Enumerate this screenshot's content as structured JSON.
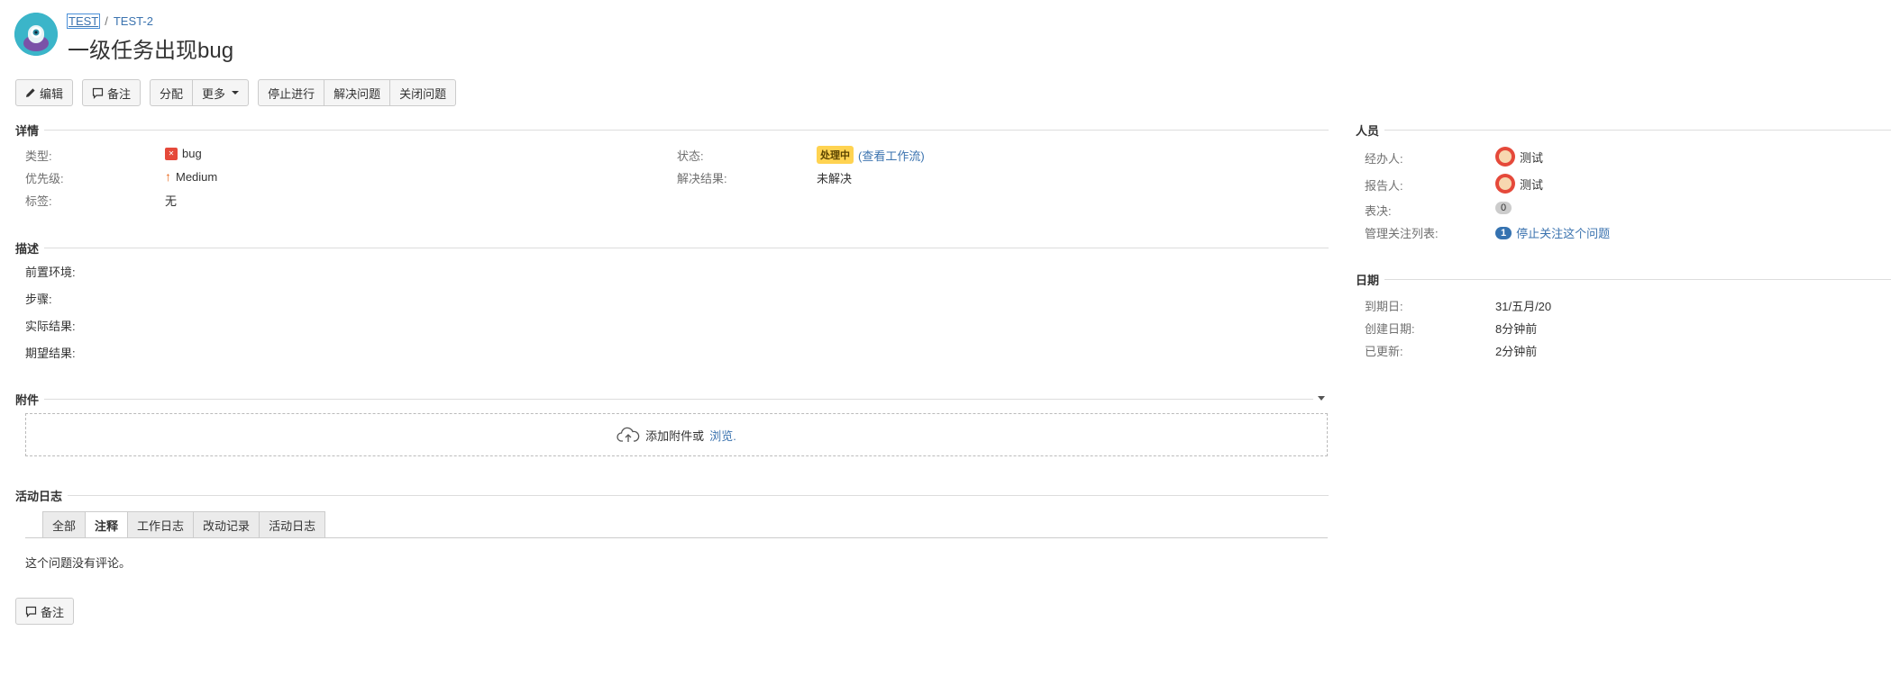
{
  "header": {
    "project_key": "TEST",
    "issue_key": "TEST-2",
    "separator": "/",
    "title": "一级任务出现bug"
  },
  "toolbar": {
    "edit": "编辑",
    "comment": "备注",
    "assign": "分配",
    "more": "更多",
    "stop_progress": "停止进行",
    "resolve": "解决问题",
    "close": "关闭问题"
  },
  "details": {
    "heading": "详情",
    "type_label": "类型:",
    "type_value": "bug",
    "priority_label": "优先级:",
    "priority_value": "Medium",
    "labels_label": "标签:",
    "labels_value": "无",
    "status_label": "状态:",
    "status_value": "处理中",
    "status_link": "(查看工作流)",
    "resolution_label": "解决结果:",
    "resolution_value": "未解决"
  },
  "description": {
    "heading": "描述",
    "lines": [
      "前置环境:",
      "步骤:",
      "实际结果:",
      "期望结果:"
    ]
  },
  "attachments": {
    "heading": "附件",
    "drop_text": "添加附件或",
    "browse": "浏览."
  },
  "activity": {
    "heading": "活动日志",
    "tabs": [
      "全部",
      "注释",
      "工作日志",
      "改动记录",
      "活动日志"
    ],
    "active_tab": "注释",
    "empty_text": "这个问题没有评论。",
    "comment_button": "备注"
  },
  "people": {
    "heading": "人员",
    "assignee_label": "经办人:",
    "assignee_value": "测试",
    "reporter_label": "报告人:",
    "reporter_value": "测试",
    "votes_label": "表决:",
    "votes_value": "0",
    "watchers_label": "管理关注列表:",
    "watchers_count": "1",
    "watchers_link": "停止关注这个问题"
  },
  "dates": {
    "heading": "日期",
    "due_label": "到期日:",
    "due_value": "31/五月/20",
    "created_label": "创建日期:",
    "created_value": "8分钟前",
    "updated_label": "已更新:",
    "updated_value": "2分钟前"
  },
  "colors": {
    "link": "#3b73af",
    "status_lozenge": "#ffd351",
    "bug": "#e5493a",
    "priority": "#e96518",
    "watch_badge": "#3572b0"
  },
  "icons": {
    "project_avatar": "project-avatar",
    "edit": "pencil-icon",
    "comment": "speech-bubble-icon",
    "type": "bug-icon",
    "priority": "arrow-up-icon",
    "upload": "cloud-upload-icon"
  }
}
